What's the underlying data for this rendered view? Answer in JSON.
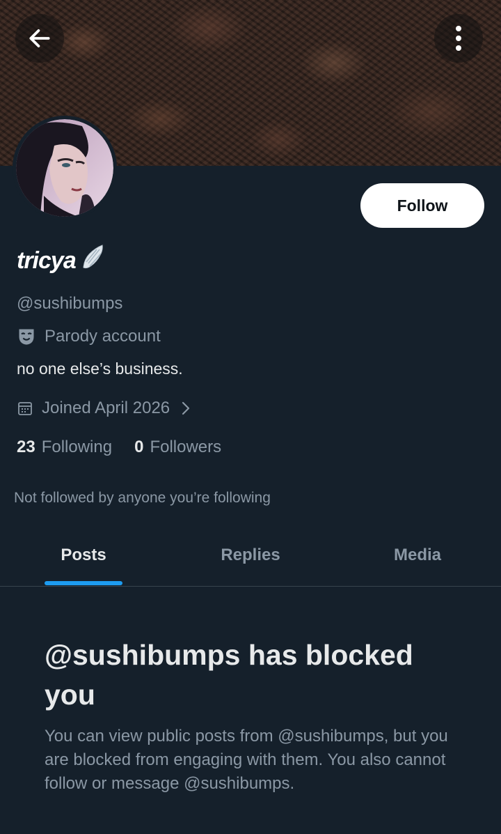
{
  "colors": {
    "background": "#15202b",
    "text_primary": "#e7e9ea",
    "text_secondary": "#8b98a5",
    "accent": "#1d9bf0",
    "follow_button_bg": "#ffffff",
    "divider": "#38444d"
  },
  "header": {
    "back_icon": "arrow-left-icon",
    "more_icon": "more-vertical-icon"
  },
  "profile": {
    "display_name": "tricya",
    "name_badge_icon": "wing-icon",
    "handle": "@sushibumps",
    "parody_icon": "parody-mask-icon",
    "parody_label": "Parody account",
    "bio": "no one else’s business.",
    "joined_icon": "calendar-icon",
    "joined": "Joined April 2026",
    "joined_chevron_icon": "chevron-right-icon",
    "following_count": "23",
    "following_label": "Following",
    "followers_count": "0",
    "followers_label": "Followers",
    "not_followed": "Not followed by anyone you’re following"
  },
  "actions": {
    "follow_label": "Follow"
  },
  "tabs": [
    {
      "label": "Posts",
      "active": true
    },
    {
      "label": "Replies",
      "active": false
    },
    {
      "label": "Media",
      "active": false
    }
  ],
  "blocked": {
    "title": "@sushibumps has blocked you",
    "description": "You can view public posts from @sushibumps, but you are blocked from engaging with them. You also cannot follow or message @sushibumps."
  }
}
